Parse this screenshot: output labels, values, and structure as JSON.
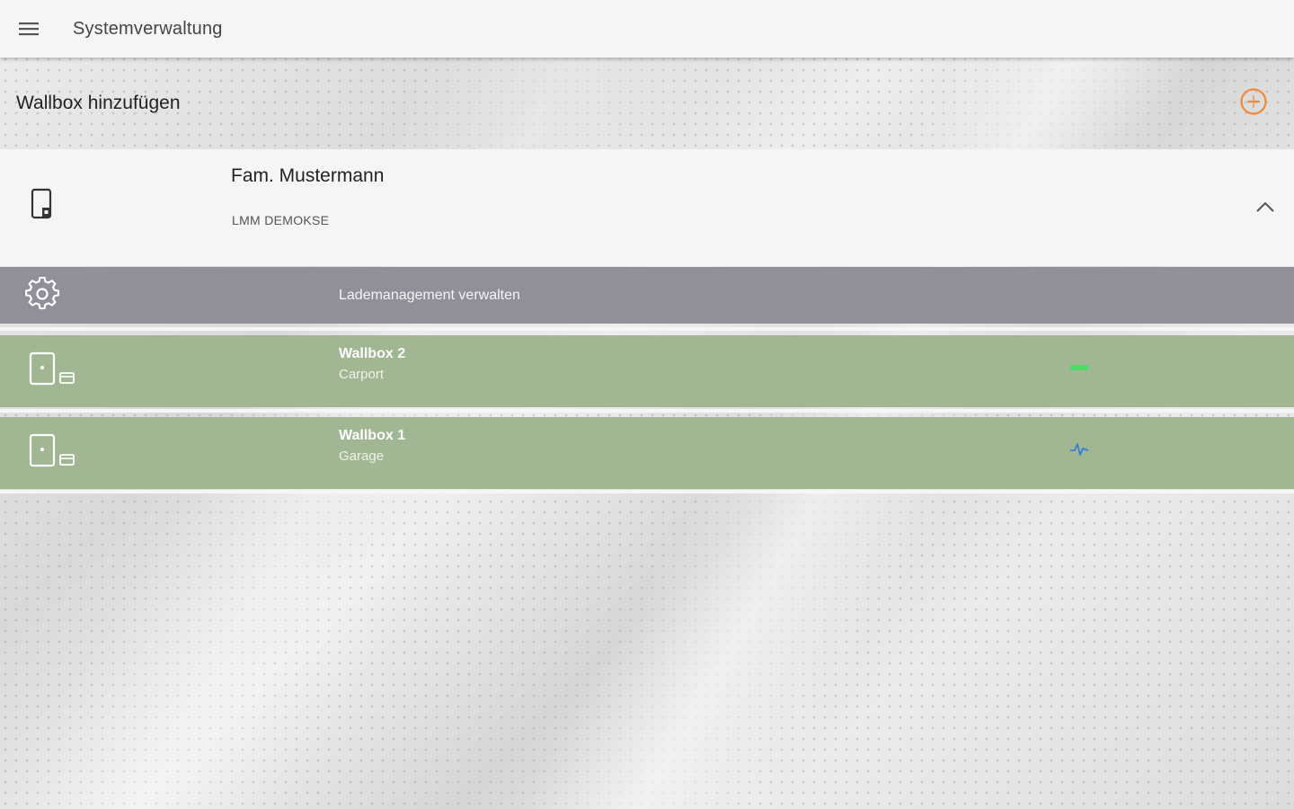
{
  "app_bar": {
    "menu_icon": "hamburger-menu-icon",
    "title": "Systemverwaltung"
  },
  "add_wallbox": {
    "label": "Wallbox hinzufügen",
    "icon": "add-circle-icon",
    "accent_color": "#f08a3c"
  },
  "group": {
    "icon": "wallbox-device-icon",
    "name": "Fam. Mustermann",
    "subtitle": "LMM DEMOKSE",
    "expand_icon": "chevron-up-icon",
    "expanded": true
  },
  "manage": {
    "icon": "gear-icon",
    "label": "Lademanagement verwalten",
    "background": "#8f9099"
  },
  "wallboxes": [
    {
      "name": "Wallbox 2",
      "location": "Carport",
      "icon": "wallbox-with-card-icon",
      "status_icon": "connected-plug-icon",
      "status_color": "#4cd964",
      "background": "#a1b692"
    },
    {
      "name": "Wallbox 1",
      "location": "Garage",
      "icon": "wallbox-with-card-icon",
      "status_icon": "activity-pulse-icon",
      "status_color": "#3a7bd5",
      "background": "#a1b692"
    }
  ]
}
